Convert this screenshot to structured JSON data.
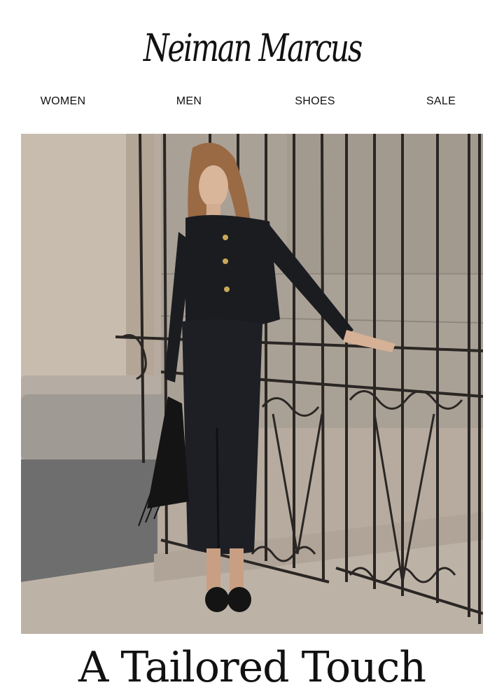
{
  "brand": {
    "logo_text": "Neiman Marcus"
  },
  "nav": {
    "items": [
      {
        "label": "WOMEN"
      },
      {
        "label": "MEN"
      },
      {
        "label": "SHOES"
      },
      {
        "label": "SALE"
      }
    ]
  },
  "hero": {
    "image_alt": "Model in black tailored jacket and midi skirt standing by wrought iron gate"
  },
  "headline": {
    "text": "A Tailored Touch"
  },
  "colors": {
    "background": "#ffffff",
    "text": "#111111",
    "outfit": "#1b1c20",
    "stone": "#c8bcae"
  }
}
